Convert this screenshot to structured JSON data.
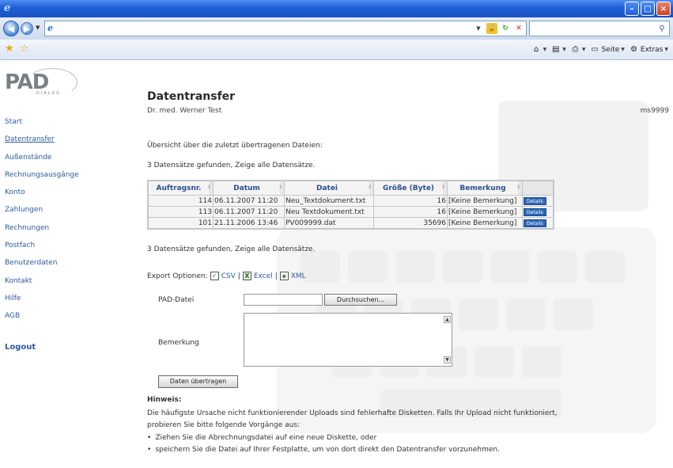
{
  "browser": {
    "window_controls": {
      "minimize": "–",
      "maximize": "□",
      "close": "×"
    },
    "address_value": "",
    "search_value": "",
    "commands": [
      {
        "icon": "home-icon",
        "label": ""
      },
      {
        "icon": "feeds-icon",
        "label": ""
      },
      {
        "icon": "print-icon",
        "label": ""
      },
      {
        "icon": "page-icon",
        "label": "Seite"
      },
      {
        "icon": "tools-icon",
        "label": "Extras"
      }
    ]
  },
  "logo": {
    "main": "PAD",
    "sub": "DIALOG"
  },
  "sidebar": {
    "items": [
      {
        "label": "Start"
      },
      {
        "label": "Datentransfer",
        "active": true
      },
      {
        "label": "Außenstände"
      },
      {
        "label": "Rechnungsausgänge"
      },
      {
        "label": "Konto"
      },
      {
        "label": "Zahlungen"
      },
      {
        "label": "Rechnungen"
      },
      {
        "label": "Postfach"
      },
      {
        "label": "Benutzerdaten"
      },
      {
        "label": "Kontakt"
      },
      {
        "label": "Hilfe"
      },
      {
        "label": "AGB"
      }
    ],
    "logout": "Logout"
  },
  "page": {
    "title": "Datentransfer",
    "doctor": "Dr. med. Werner Test",
    "user_id": "ms9999",
    "overview": "Übersicht über die zuletzt übertragenen Dateien:",
    "records_found": "3 Datensätze gefunden, Zeige alle Datensätze."
  },
  "table": {
    "headers": [
      "Auftragsnr.",
      "Datum",
      "Datei",
      "Größe (Byte)",
      "Bemerkung"
    ],
    "details_label": "Details",
    "rows": [
      {
        "auftragsnr": "114",
        "datum": "06.11.2007 11:20",
        "datei": "Neu_Textdokument.txt",
        "groesse": "16",
        "bemerkung": "[Keine Bemerkung]"
      },
      {
        "auftragsnr": "113",
        "datum": "06.11.2007 11:20",
        "datei": "Neu Textdokument.txt",
        "groesse": "16",
        "bemerkung": "[Keine Bemerkung]"
      },
      {
        "auftragsnr": "101",
        "datum": "21.11.2006 13:46",
        "datei": "PV009999.dat",
        "groesse": "35696",
        "bemerkung": "[Keine Bemerkung]"
      }
    ]
  },
  "export": {
    "label": "Export Optionen:",
    "options": [
      "CSV",
      "Excel",
      "XML"
    ],
    "separator": "|"
  },
  "form": {
    "pad_label": "PAD-Datei",
    "pad_value": "",
    "browse_label": "Durchsuchen...",
    "remark_label": "Bemerkung",
    "remark_value": "",
    "submit_label": "Daten übertragen"
  },
  "hint": {
    "title": "Hinweis:",
    "text": "Die häufigste Ursache nicht funktionierender Uploads sind fehlerhafte Disketten. Falls Ihr Upload nicht funktioniert, probieren Sie bitte folgende Vorgänge aus:",
    "bullets": [
      "Ziehen Sie die Abrechnungsdatei auf eine neue Diskette, oder",
      "speichern Sie die Datei auf Ihrer Festplatte, um von dort direkt den Datentransfer vorzunehmen."
    ]
  }
}
